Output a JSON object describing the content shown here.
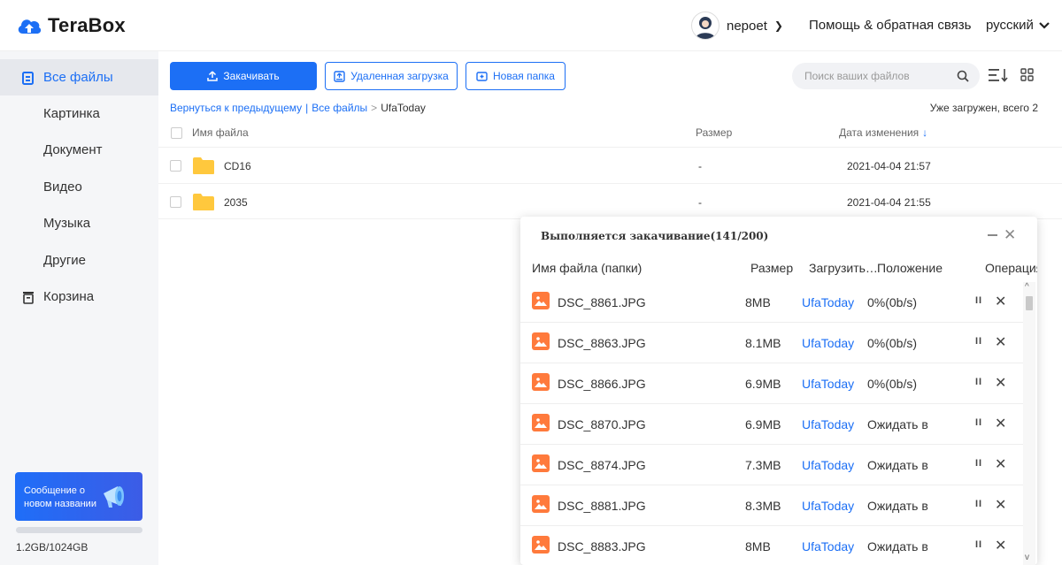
{
  "header": {
    "brand": "TeraBox",
    "username": "nepoet",
    "help": "Помощь & обратная связь",
    "language": "русский"
  },
  "sidebar": {
    "items": [
      {
        "label": "Все файлы",
        "icon": "files-icon",
        "active": true
      },
      {
        "label": "Картинка"
      },
      {
        "label": "Документ"
      },
      {
        "label": "Видео"
      },
      {
        "label": "Музыка"
      },
      {
        "label": "Другие"
      },
      {
        "label": "Корзина",
        "icon": "trash-icon"
      }
    ],
    "promo": "Сообщение о новом названии",
    "quota": "1.2GB/1024GB",
    "quota_used_fraction": 0.0012
  },
  "toolbar": {
    "upload": "Закачивать",
    "remote": "Удаленная загрузка",
    "new_folder": "Новая папка",
    "search_placeholder": "Поиск ваших файлов"
  },
  "breadcrumb": {
    "back": "Вернуться к предыдущему",
    "sep1": "|",
    "all": "Все файлы",
    "sep2": ">",
    "current": "UfaToday"
  },
  "loaded_status": "Уже загружен, всего 2",
  "table": {
    "columns": {
      "name": "Имя файла",
      "size": "Размер",
      "date": "Дата изменения"
    },
    "rows": [
      {
        "name": "CD16",
        "size": "-",
        "date": "2021-04-04 21:57"
      },
      {
        "name": "2035",
        "size": "-",
        "date": "2021-04-04 21:55"
      }
    ]
  },
  "upload_panel": {
    "title": "Выполняется закачивание(141/200)",
    "columns": {
      "name": "Имя файла (папки)",
      "size": "Размер",
      "dest": "Загрузить…",
      "status": "Положение",
      "ops": "Операция"
    },
    "rows": [
      {
        "name": "DSC_8861.JPG",
        "size": "8MB",
        "dest": "UfaToday",
        "status": "0%(0b/s)"
      },
      {
        "name": "DSC_8863.JPG",
        "size": "8.1MB",
        "dest": "UfaToday",
        "status": "0%(0b/s)"
      },
      {
        "name": "DSC_8866.JPG",
        "size": "6.9MB",
        "dest": "UfaToday",
        "status": "0%(0b/s)"
      },
      {
        "name": "DSC_8870.JPG",
        "size": "6.9MB",
        "dest": "UfaToday",
        "status": "Ожидать в"
      },
      {
        "name": "DSC_8874.JPG",
        "size": "7.3MB",
        "dest": "UfaToday",
        "status": "Ожидать в"
      },
      {
        "name": "DSC_8881.JPG",
        "size": "8.3MB",
        "dest": "UfaToday",
        "status": "Ожидать в"
      },
      {
        "name": "DSC_8883.JPG",
        "size": "8MB",
        "dest": "UfaToday",
        "status": "Ожидать в"
      }
    ]
  },
  "colors": {
    "accent": "#1c6ff5",
    "image_icon": "#ff7a3c",
    "folder": "#ffc83d"
  }
}
